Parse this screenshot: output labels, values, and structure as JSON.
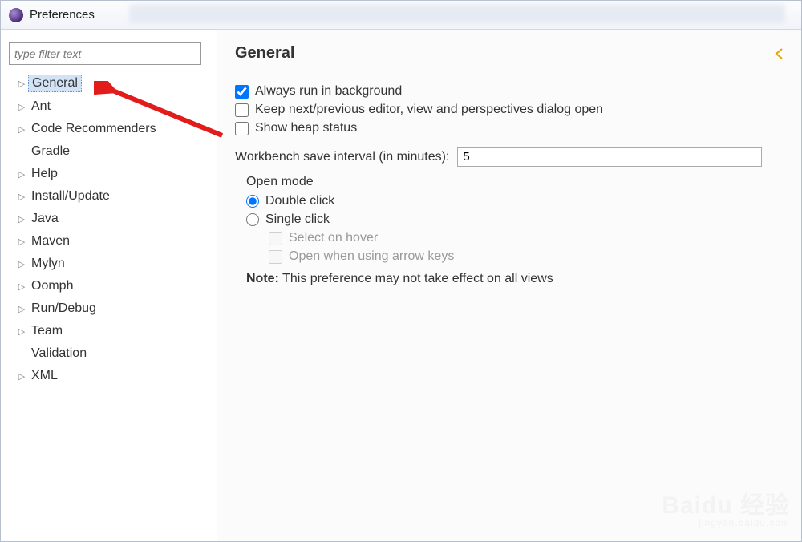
{
  "window": {
    "title": "Preferences"
  },
  "sidebar": {
    "filter_placeholder": "type filter text",
    "items": [
      {
        "label": "General",
        "expandable": true,
        "selected": true
      },
      {
        "label": "Ant",
        "expandable": true
      },
      {
        "label": "Code Recommenders",
        "expandable": true
      },
      {
        "label": "Gradle",
        "expandable": false
      },
      {
        "label": "Help",
        "expandable": true
      },
      {
        "label": "Install/Update",
        "expandable": true
      },
      {
        "label": "Java",
        "expandable": true
      },
      {
        "label": "Maven",
        "expandable": true
      },
      {
        "label": "Mylyn",
        "expandable": true
      },
      {
        "label": "Oomph",
        "expandable": true
      },
      {
        "label": "Run/Debug",
        "expandable": true
      },
      {
        "label": "Team",
        "expandable": true
      },
      {
        "label": "Validation",
        "expandable": false
      },
      {
        "label": "XML",
        "expandable": true
      }
    ]
  },
  "main": {
    "title": "General",
    "checkboxes": {
      "always_bg": {
        "label": "Always run in background",
        "checked": true
      },
      "keep_dialog": {
        "label": "Keep next/previous editor, view and perspectives dialog open",
        "checked": false
      },
      "heap": {
        "label": "Show heap status",
        "checked": false
      }
    },
    "save_interval": {
      "label": "Workbench save interval (in minutes):",
      "value": "5"
    },
    "open_mode": {
      "title": "Open mode",
      "double": "Double click",
      "single": "Single click",
      "select_hover": "Select on hover",
      "arrow_keys": "Open when using arrow keys"
    },
    "note": {
      "label": "Note:",
      "text": "This preference may not take effect on all views"
    }
  },
  "watermark": {
    "brand": "Baidu 经验",
    "sub": "jingyan.baidu.com"
  }
}
